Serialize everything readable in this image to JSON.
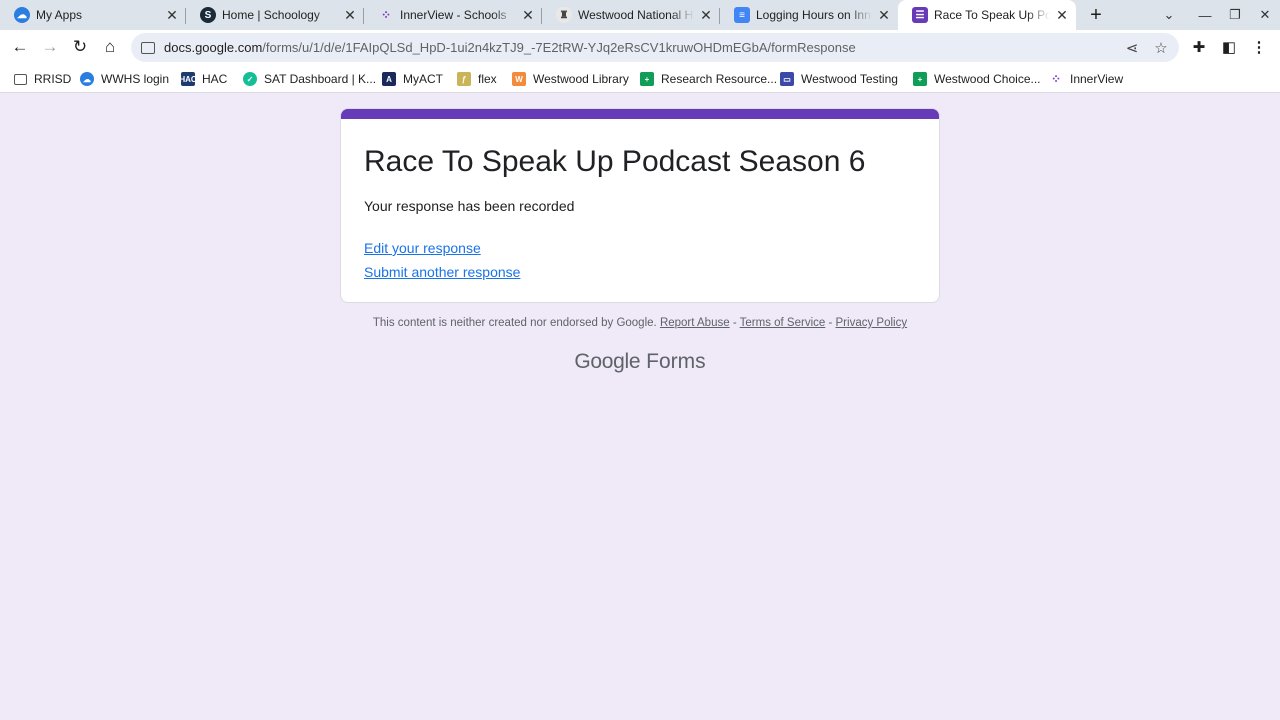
{
  "tabs": [
    {
      "title": "My Apps",
      "icon": "cloud-icon"
    },
    {
      "title": "Home | Schoology",
      "icon": "schoology-icon"
    },
    {
      "title": "InnerView - Schools",
      "icon": "innerview-icon"
    },
    {
      "title": "Westwood National Ho",
      "icon": "shield-icon"
    },
    {
      "title": "Logging Hours on Inne",
      "icon": "docs-icon"
    },
    {
      "title": "Race To Speak Up Podc",
      "icon": "forms-icon"
    }
  ],
  "address_bar": {
    "host": "docs.google.com",
    "path": "/forms/u/1/d/e/1FAIpQLSd_HpD-1ui2n4kzTJ9_-7E2tRW-YJq2eRsCV1kruwOHDmEGbA/formResponse"
  },
  "bookmarks": [
    {
      "label": "RRISD",
      "icon": "folder-icon"
    },
    {
      "label": "WWHS login",
      "icon": "cloud-icon"
    },
    {
      "label": "HAC",
      "icon": "hac-icon"
    },
    {
      "label": "SAT Dashboard | K...",
      "icon": "khan-icon"
    },
    {
      "label": "MyACT",
      "icon": "act-icon"
    },
    {
      "label": "flex",
      "icon": "flex-icon"
    },
    {
      "label": "Westwood Library",
      "icon": "library-icon"
    },
    {
      "label": "Research Resource...",
      "icon": "sheets-icon"
    },
    {
      "label": "Westwood Testing",
      "icon": "sites-icon"
    },
    {
      "label": "Westwood Choice...",
      "icon": "sheets-icon"
    },
    {
      "label": "InnerView",
      "icon": "innerview-icon"
    }
  ],
  "form": {
    "title": "Race To Speak Up Podcast Season 6",
    "confirmation": "Your response has been recorded",
    "edit_link": "Edit your response",
    "submit_another_link": "Submit another response",
    "accent_color": "#673ab7"
  },
  "footer": {
    "disclaimer": "This content is neither created nor endorsed by Google.",
    "report_abuse": "Report Abuse",
    "sep": " - ",
    "terms": "Terms of Service",
    "privacy": "Privacy Policy",
    "brand_google": "Google",
    "brand_forms": "Forms"
  }
}
